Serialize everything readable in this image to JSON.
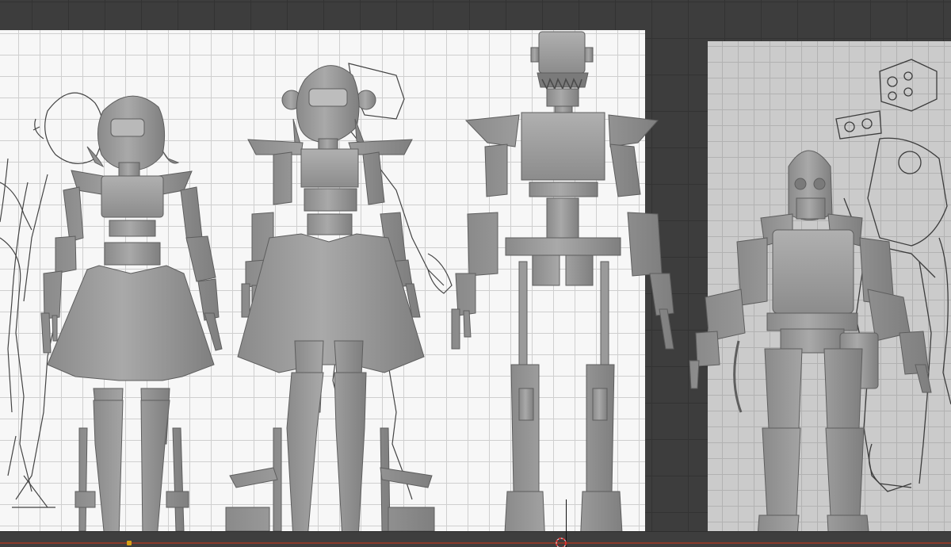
{
  "app": "Blender",
  "viewport": {
    "view": "front-orthographic",
    "background_color": "#3d3d3d",
    "reference_images": [
      {
        "name": "character-lineup-sketch",
        "tone": "#f7f7f7"
      },
      {
        "name": "armored-robot-sketch",
        "tone": "#cbcbcb"
      }
    ],
    "models": [
      {
        "name": "girl-robot-short-hair",
        "material": "#9a9a9a"
      },
      {
        "name": "girl-robot-bun-hair",
        "material": "#9a9a9a"
      },
      {
        "name": "tv-head-robot",
        "material": "#9a9a9a"
      },
      {
        "name": "diver-helmet-robot",
        "material": "#9a9a9a"
      }
    ]
  },
  "timeline": {
    "accent_color": "#8a3a2a"
  },
  "cursor": {
    "icon": "3d-cursor-icon"
  }
}
